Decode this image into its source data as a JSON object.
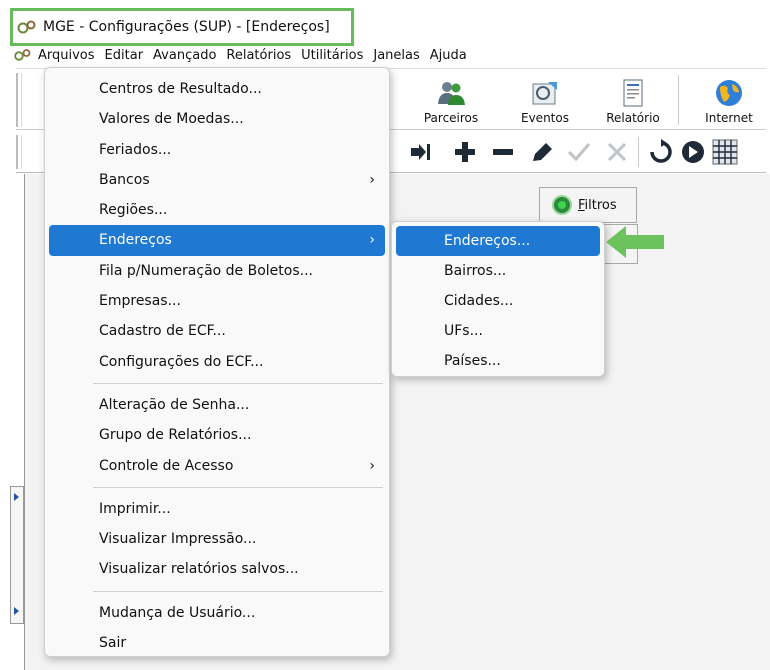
{
  "window": {
    "title": "MGE - Configurações (SUP) - [Endereços]"
  },
  "menubar": {
    "items": [
      "Arquivos",
      "Editar",
      "Avançado",
      "Relatórios",
      "Utilitários",
      "Janelas",
      "Ajuda"
    ]
  },
  "toolbar": {
    "buttons": [
      {
        "label": "Parceiros",
        "icon": "people-icon"
      },
      {
        "label": "Eventos",
        "icon": "events-icon"
      },
      {
        "label": "Relatório",
        "icon": "report-icon"
      },
      {
        "label": "Internet",
        "icon": "globe-icon"
      }
    ]
  },
  "filters": {
    "label": "Filtros"
  },
  "menu": {
    "items": [
      {
        "label": "Centros de Resultado..."
      },
      {
        "label": "Valores de Moedas..."
      },
      {
        "label": "Feriados..."
      },
      {
        "label": "Bancos",
        "submenu": true
      },
      {
        "label": "Regiões..."
      },
      {
        "label": "Endereços",
        "submenu": true,
        "highlighted": true
      },
      {
        "label": "Fila p/Numeração de Boletos..."
      },
      {
        "label": "Empresas..."
      },
      {
        "label": "Cadastro de ECF..."
      },
      {
        "label": "Configurações do ECF..."
      },
      {
        "label": "Alteração de Senha..."
      },
      {
        "label": "Grupo de Relatórios..."
      },
      {
        "label": "Controle de Acesso",
        "submenu": true
      },
      {
        "label": "Imprimir..."
      },
      {
        "label": "Visualizar Impressão..."
      },
      {
        "label": "Visualizar relatórios salvos..."
      },
      {
        "label": "Mudança de Usuário..."
      },
      {
        "label": "Sair"
      }
    ],
    "chevron": "›"
  },
  "submenu": {
    "items": [
      {
        "label": "Endereços...",
        "highlighted": true
      },
      {
        "label": "Bairros..."
      },
      {
        "label": "Cidades..."
      },
      {
        "label": "UFs..."
      },
      {
        "label": "Países..."
      }
    ]
  },
  "colors": {
    "highlight": "#1f78d1",
    "annotation": "#66bb5a"
  }
}
